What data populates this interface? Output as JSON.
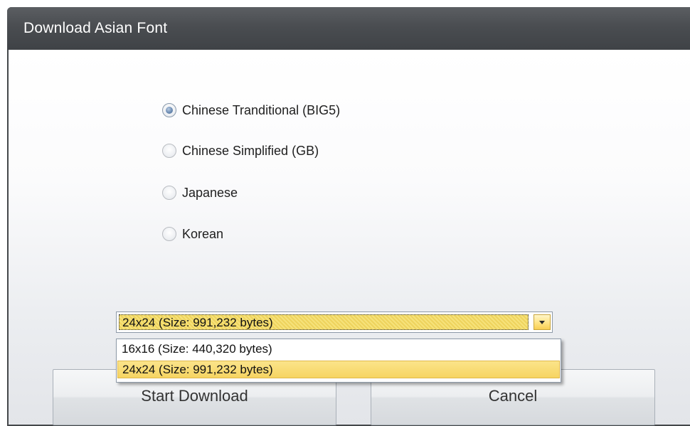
{
  "window": {
    "title": "Download Asian Font"
  },
  "font_options": [
    {
      "label": "Chinese Tranditional (BIG5)",
      "checked": true
    },
    {
      "label": "Chinese Simplified (GB)",
      "checked": false
    },
    {
      "label": "Japanese",
      "checked": false
    },
    {
      "label": "Korean",
      "checked": false
    }
  ],
  "size_combo": {
    "selected": "24x24 (Size: 991,232 bytes)",
    "options": [
      "16x16 (Size: 440,320 bytes)",
      "24x24 (Size: 991,232 bytes)"
    ],
    "highlighted_index": 1
  },
  "buttons": {
    "start_label": "Start Download",
    "cancel_label": "Cancel"
  },
  "colors": {
    "titlebar": "#4a4d51",
    "highlight": "#f6d462",
    "radio_accent": "#6d8cb3"
  }
}
